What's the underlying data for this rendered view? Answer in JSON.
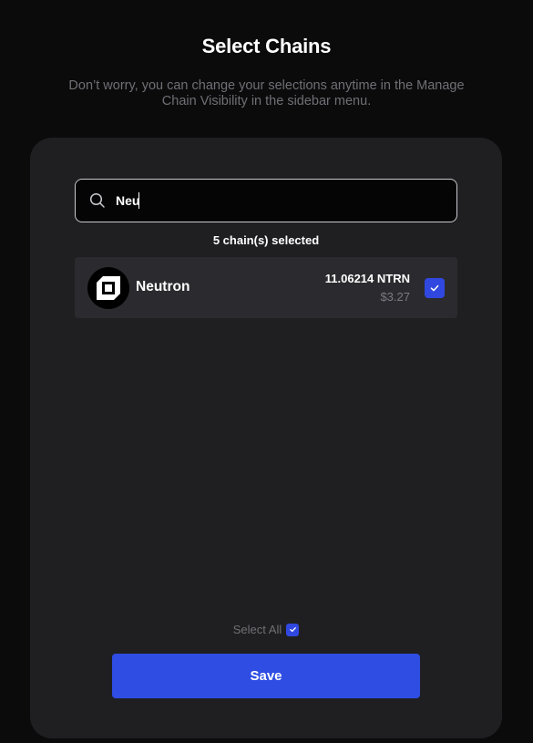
{
  "header": {
    "title": "Select Chains",
    "subtitle": "Don’t worry, you can change your selections anytime in the Manage Chain Visibility in the sidebar menu."
  },
  "search": {
    "value": "Neu",
    "icon": "search-icon"
  },
  "selection_count": "5 chain(s) selected",
  "chains": [
    {
      "name": "Neutron",
      "balance": "11.06214 NTRN",
      "usd_value": "$3.27",
      "selected": true,
      "icon": "neutron-logo"
    }
  ],
  "footer": {
    "select_all_label": "Select All",
    "select_all_checked": true,
    "save_label": "Save"
  },
  "colors": {
    "background": "#0b0b0c",
    "card": "#1f1f22",
    "row": "#2b2b2f",
    "accent": "#2f4de3"
  }
}
